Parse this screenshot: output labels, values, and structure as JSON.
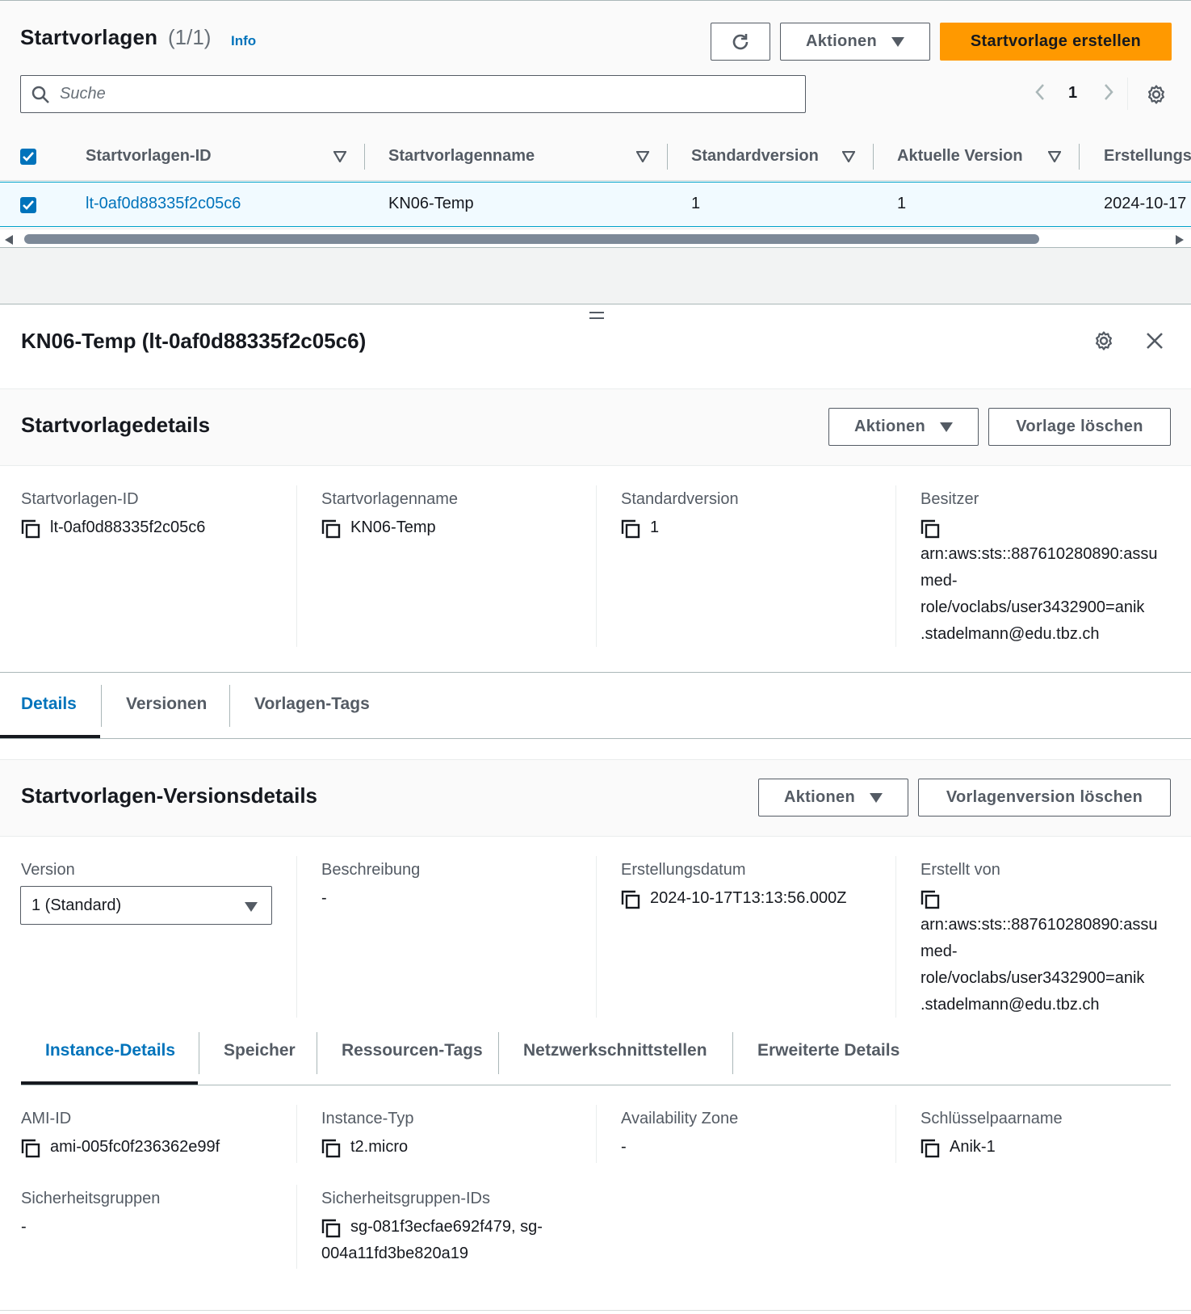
{
  "list": {
    "title": "Startvorlagen",
    "count": "(1/1)",
    "info": "Info",
    "actions_label": "Aktionen",
    "create_label": "Startvorlage erstellen",
    "search_placeholder": "Suche",
    "page": "1",
    "columns": [
      "Startvorlagen-ID",
      "Startvorlagenname",
      "Standardversion",
      "Aktuelle Version",
      "Erstellungs"
    ],
    "rows": [
      {
        "id": "lt-0af0d88335f2c05c6",
        "name": "KN06-Temp",
        "default_version": "1",
        "current_version": "1",
        "created": "2024-10-17"
      }
    ]
  },
  "split": {
    "title": "KN06-Temp (lt-0af0d88335f2c05c6)",
    "details": {
      "title": "Startvorlagedetails",
      "actions_label": "Aktionen",
      "delete_label": "Vorlage löschen",
      "fields": [
        {
          "label": "Startvorlagen-ID",
          "value": "lt-0af0d88335f2c05c6"
        },
        {
          "label": "Startvorlagenname",
          "value": "KN06-Temp"
        },
        {
          "label": "Standardversion",
          "value": "1"
        },
        {
          "label": "Besitzer",
          "lines": [
            "arn:aws:sts::887610280890:assu",
            "med-",
            "role/voclabs/user3432900=anik",
            ".stadelmann@edu.tbz.ch"
          ]
        }
      ]
    },
    "tabs": [
      "Details",
      "Versionen",
      "Vorlagen-Tags"
    ],
    "version_details": {
      "title": "Startvorlagen-Versionsdetails",
      "actions_label": "Aktionen",
      "delete_label": "Vorlagenversion löschen",
      "version_label": "Version",
      "version_selected": "1 (Standard)",
      "description_label": "Beschreibung",
      "description_value": "-",
      "created_label": "Erstellungsdatum",
      "created_value": "2024-10-17T13:13:56.000Z",
      "created_by_label": "Erstellt von",
      "created_by_lines": [
        "arn:aws:sts::887610280890:assu",
        "med-",
        "role/voclabs/user3432900=anik",
        ".stadelmann@edu.tbz.ch"
      ]
    },
    "inner_tabs": [
      "Instance-Details",
      "Speicher",
      "Ressourcen-Tags",
      "Netzwerkschnittstellen",
      "Erweiterte Details"
    ],
    "instance": {
      "ami_label": "AMI-ID",
      "ami_value": "ami-005fc0f236362e99f",
      "type_label": "Instance-Typ",
      "type_value": "t2.micro",
      "az_label": "Availability Zone",
      "az_value": "-",
      "key_label": "Schlüsselpaarname",
      "key_value": "Anik-1",
      "sg_label": "Sicherheitsgruppen",
      "sg_value": "-",
      "sgid_label": "Sicherheitsgruppen-IDs",
      "sgid_lines": [
        "sg-081f3ecfae692f479, sg-",
        "004a11fd3be820a19"
      ]
    }
  },
  "colors": {
    "primary": "#ff9900",
    "link": "#0073bb",
    "text": "#16191f",
    "muted": "#545b64"
  }
}
